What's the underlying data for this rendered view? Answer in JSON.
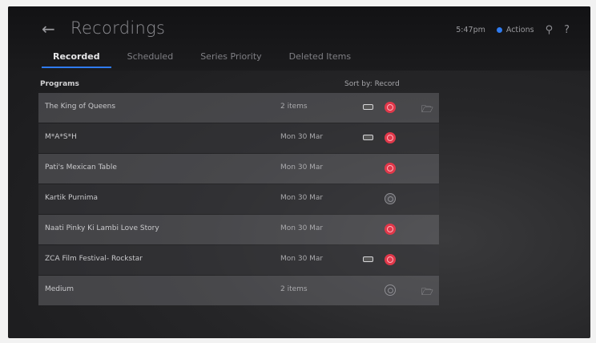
{
  "header": {
    "back_icon": "arrow-left-icon",
    "title": "Recordings",
    "time": "5:47pm",
    "actions_label": "Actions",
    "search_icon": "search-icon",
    "help_icon": "help-icon"
  },
  "tabs": [
    {
      "label": "Recorded",
      "active": true
    },
    {
      "label": "Scheduled",
      "active": false
    },
    {
      "label": "Series Priority",
      "active": false
    },
    {
      "label": "Deleted Items",
      "active": false
    }
  ],
  "list_header": {
    "programs_label": "Programs",
    "sort_label": "Sort by: Record"
  },
  "rows": [
    {
      "name": "The King of Queens",
      "meta": "2 items",
      "icons": [
        "hdd-icon",
        "record-icon",
        "folder-icon"
      ]
    },
    {
      "name": "M*A*S*H",
      "meta": "Mon 30 Mar",
      "icons": [
        "hdd-icon",
        "record-icon"
      ]
    },
    {
      "name": "Pati's Mexican Table",
      "meta": "Mon 30 Mar",
      "icons": [
        "record-icon"
      ]
    },
    {
      "name": "Kartik Purnima",
      "meta": "Mon 30 Mar",
      "icons": [
        "record-grey-icon"
      ]
    },
    {
      "name": "Naati Pinky Ki Lambi Love Story",
      "meta": "Mon 30 Mar",
      "icons": [
        "record-icon"
      ]
    },
    {
      "name": "ZCA Film Festival- Rockstar",
      "meta": "Mon 30 Mar",
      "icons": [
        "hdd-icon",
        "record-icon"
      ]
    },
    {
      "name": "Medium",
      "meta": "2 items",
      "icons": [
        "record-grey-icon",
        "folder-icon"
      ]
    }
  ],
  "colors": {
    "accent": "#2f7bf0",
    "record": "#e0384a"
  }
}
